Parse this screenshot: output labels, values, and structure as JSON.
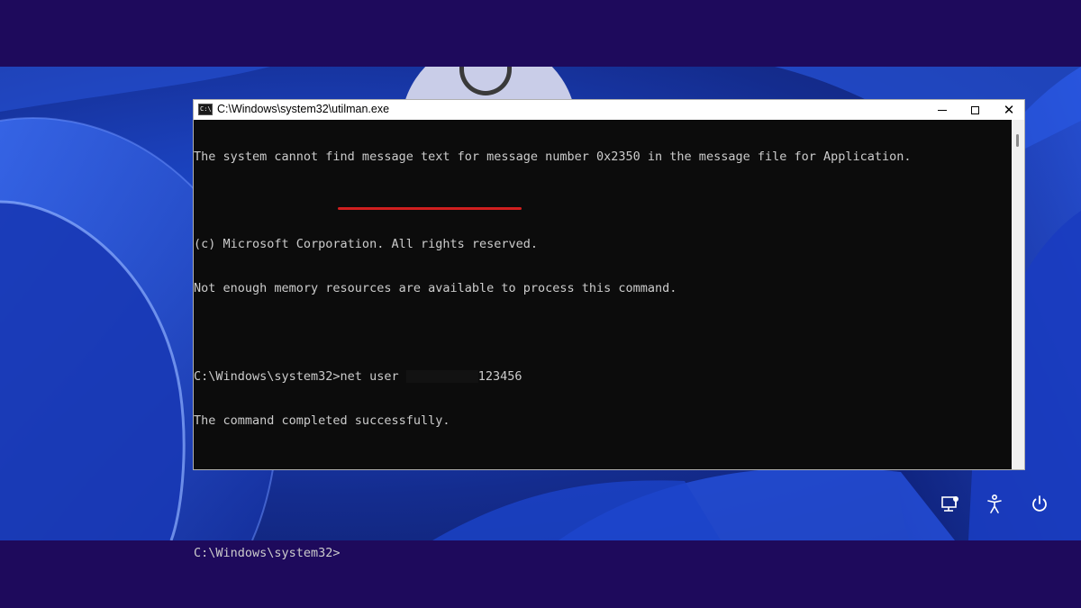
{
  "window": {
    "title": "C:\\Windows\\system32\\utilman.exe",
    "icon_text": "C:\\"
  },
  "terminal": {
    "lines": [
      "The system cannot find message text for message number 0x2350 in the message file for Application.",
      "",
      "(c) Microsoft Corporation. All rights reserved.",
      "Not enough memory resources are available to process this command.",
      "",
      "C:\\Windows\\system32>net user ",
      "The command completed successfully.",
      "",
      "",
      "C:\\Windows\\system32>"
    ],
    "command_password": "123456"
  },
  "icons": {
    "network": "network-icon",
    "accessibility": "accessibility-icon",
    "power": "power-icon"
  },
  "colors": {
    "background": "#1e0a5c",
    "console_bg": "#0c0c0c",
    "console_text": "#cccccc",
    "highlight": "#d11f1f"
  }
}
